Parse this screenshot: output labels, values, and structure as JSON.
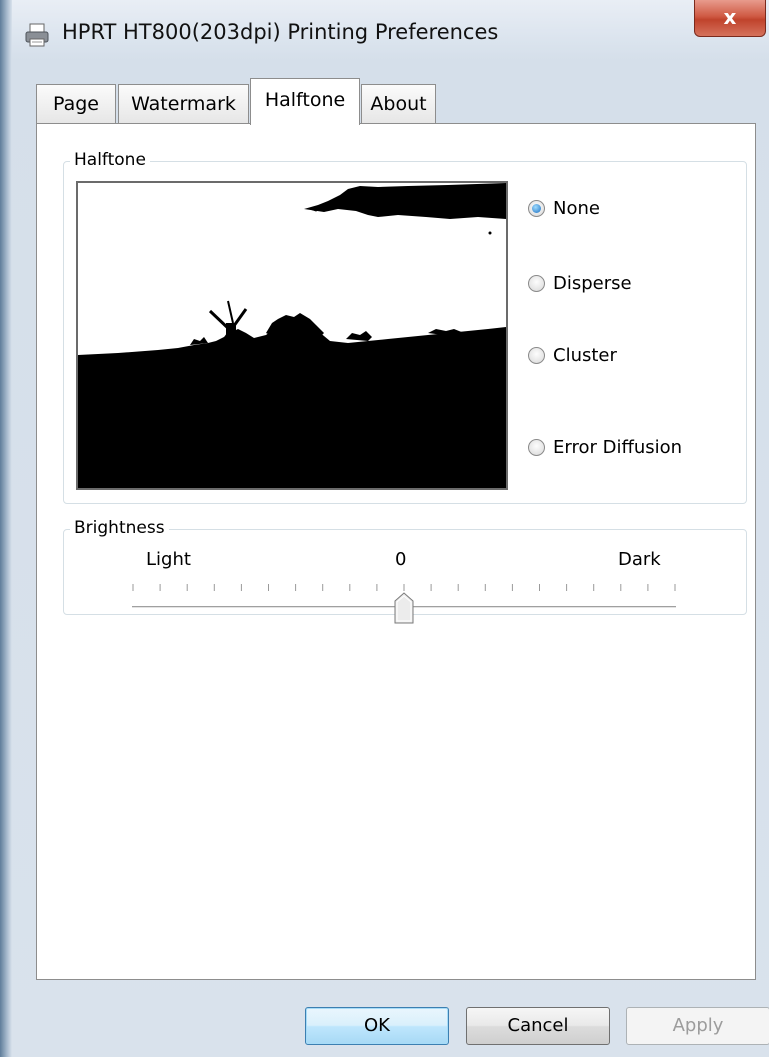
{
  "window": {
    "title": "HPRT HT800(203dpi) Printing Preferences",
    "close_glyph": "x",
    "icon": "printer-icon"
  },
  "tabs": [
    {
      "label": "Page",
      "active": false
    },
    {
      "label": "Watermark",
      "active": false
    },
    {
      "label": "Halftone",
      "active": true
    },
    {
      "label": "About",
      "active": false
    }
  ],
  "halftone": {
    "group_label": "Halftone",
    "options": [
      {
        "label": "None",
        "checked": true
      },
      {
        "label": "Disperse",
        "checked": false
      },
      {
        "label": "Cluster",
        "checked": false
      },
      {
        "label": "Error Diffusion",
        "checked": false
      }
    ]
  },
  "brightness": {
    "group_label": "Brightness",
    "min_label": "Light",
    "value_label": "0",
    "max_label": "Dark",
    "value_fraction": 0.5
  },
  "buttons": {
    "ok": "OK",
    "cancel": "Cancel",
    "apply": "Apply"
  },
  "colors": {
    "close_button": "#c0432c",
    "radio_checked": "#1c6fc1",
    "default_button": "#bee6fd"
  }
}
